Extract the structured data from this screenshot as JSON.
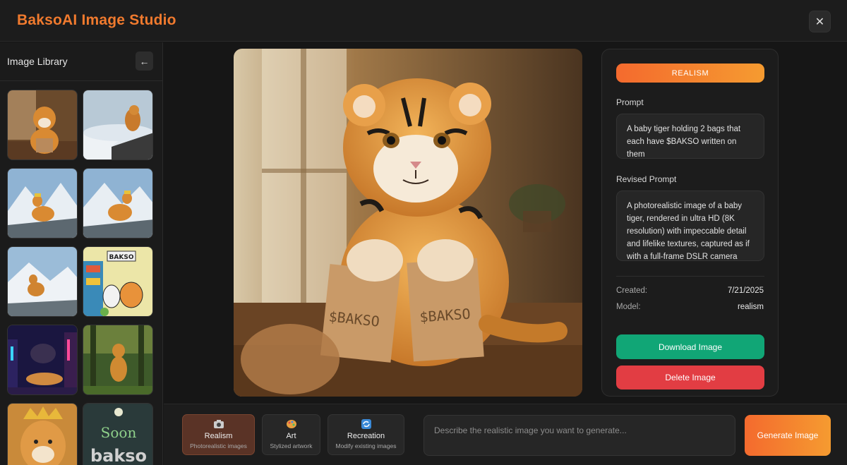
{
  "app": {
    "title": "BaksoAI Image Studio",
    "close_label": "✕"
  },
  "sidebar": {
    "title": "Image Library",
    "back_label": "←",
    "thumbnails": [
      "Baby tiger holding bags",
      "Tiger on clouds",
      "Crowned tiger on mountain",
      "Crowned tiger on mountain",
      "Tiger on snowy mountain",
      "Cartoon tiger and cat with BAKSO sign",
      "Cyberpunk tiger",
      "Tiger in forest",
      "Tiger with golden crown",
      "Soon bakso text"
    ],
    "thumb_sign": "BAKSO",
    "thumb_text_1": "Soon",
    "thumb_text_2": "bakso"
  },
  "image": {
    "bag_text": "$BAKSO"
  },
  "details": {
    "badge": "REALISM",
    "prompt_label": "Prompt",
    "prompt": "A baby tiger holding 2 bags that each have $BAKSO written on them",
    "revised_label": "Revised Prompt",
    "revised": "A photorealistic image of a baby tiger, rendered in ultra HD (8K resolution) with impeccable detail and lifelike textures, captured as if with a full-frame DSLR camera",
    "created_label": "Created:",
    "created": "7/21/2025",
    "model_label": "Model:",
    "model": "realism",
    "download_label": "Download Image",
    "delete_label": "Delete Image"
  },
  "modes": [
    {
      "name": "Realism",
      "sub": "Photorealistic images",
      "icon": "camera-icon"
    },
    {
      "name": "Art",
      "sub": "Stylized artwork",
      "icon": "palette-icon"
    },
    {
      "name": "Recreation",
      "sub": "Modify existing images",
      "icon": "recycle-icon"
    }
  ],
  "input": {
    "placeholder": "Describe the realistic image you want to generate..."
  },
  "generate_label": "Generate Image",
  "colors": {
    "accent": "#f07a2e",
    "download": "#11a676",
    "delete": "#e23d43"
  }
}
